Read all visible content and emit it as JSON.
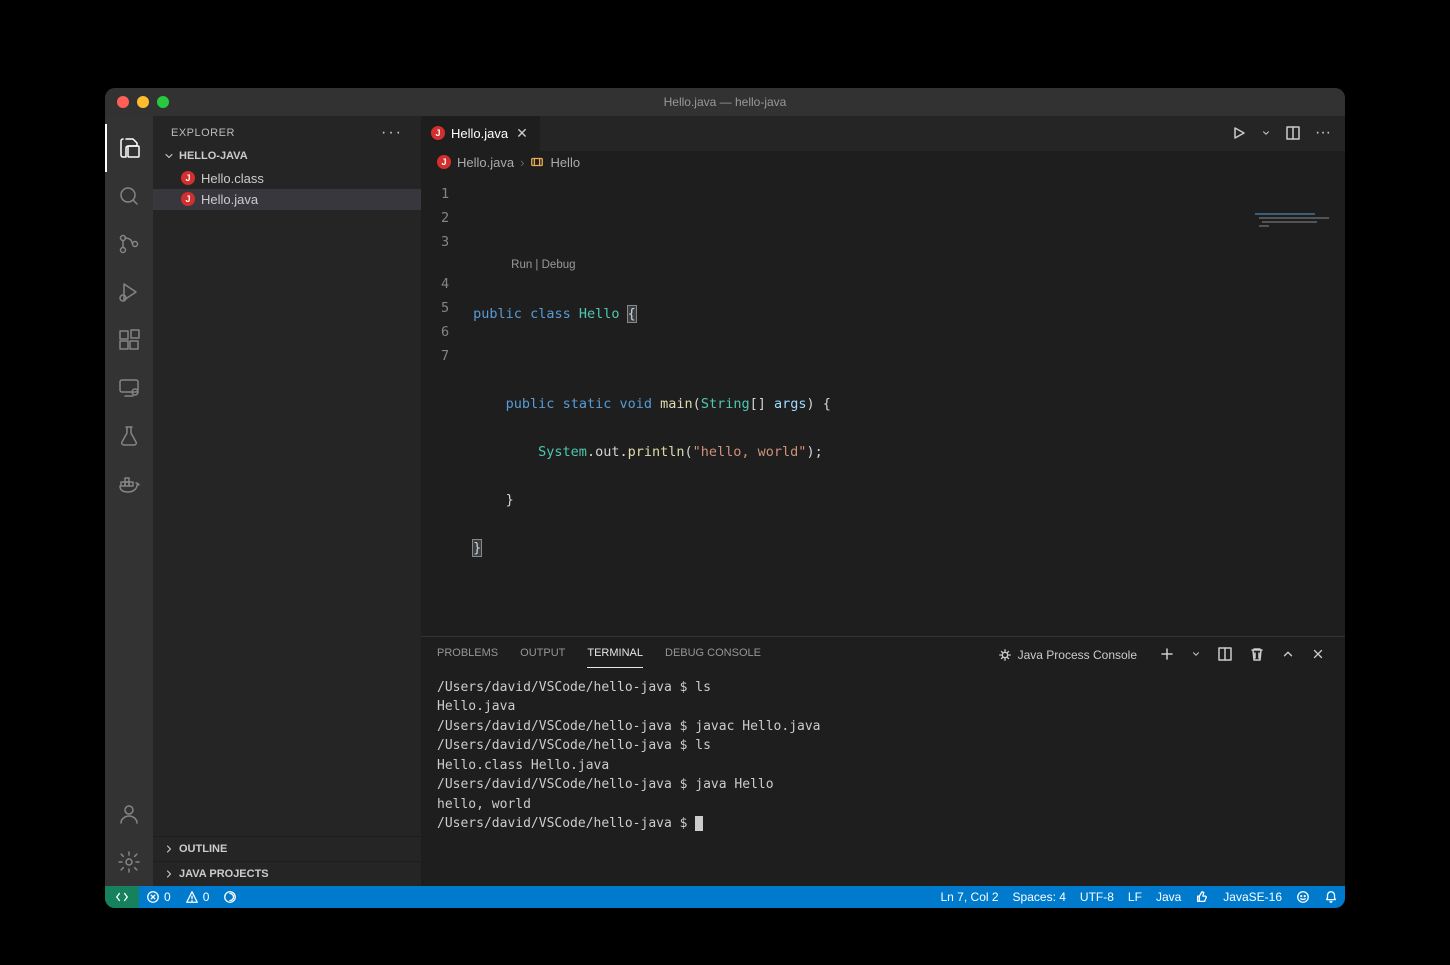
{
  "window": {
    "title": "Hello.java — hello-java"
  },
  "sidebar": {
    "title": "EXPLORER",
    "folder": "HELLO-JAVA",
    "files": [
      {
        "name": "Hello.class",
        "active": false
      },
      {
        "name": "Hello.java",
        "active": true
      }
    ],
    "panels": [
      "OUTLINE",
      "JAVA PROJECTS"
    ]
  },
  "tab": {
    "label": "Hello.java"
  },
  "breadcrumb": {
    "file": "Hello.java",
    "symbol": "Hello"
  },
  "code": {
    "lines": [
      "1",
      "2",
      "3",
      "4",
      "5",
      "6",
      "7"
    ],
    "codelens": "Run | Debug",
    "text": {
      "l3_public": "public",
      "l3_class": "class",
      "l3_Hello": "Hello",
      "l3_brace": "{",
      "l4_public": "public",
      "l4_static": "static",
      "l4_void": "void",
      "l4_main": "main",
      "l4_String": "String",
      "l4_brackets": "[]",
      "l4_args": "args",
      "l4_rest": ") {",
      "l5_System": "System",
      "l5_out": ".out.",
      "l5_println": "println",
      "l5_openp": "(",
      "l5_str": "\"hello, world\"",
      "l5_closep": ");",
      "l6_brace": "    }",
      "l7_brace": "}"
    }
  },
  "panel": {
    "tabs": [
      "PROBLEMS",
      "OUTPUT",
      "TERMINAL",
      "DEBUG CONSOLE"
    ],
    "active": "TERMINAL",
    "terminal_label": "Java Process Console"
  },
  "terminal": {
    "lines": [
      "/Users/david/VSCode/hello-java $ ls",
      "Hello.java",
      "/Users/david/VSCode/hello-java $ javac Hello.java",
      "/Users/david/VSCode/hello-java $ ls",
      "Hello.class Hello.java",
      "/Users/david/VSCode/hello-java $ java Hello",
      "hello, world",
      "/Users/david/VSCode/hello-java $ "
    ]
  },
  "status": {
    "errors": "0",
    "warnings": "0",
    "cursor": "Ln 7, Col 2",
    "spaces": "Spaces: 4",
    "encoding": "UTF-8",
    "eol": "LF",
    "lang": "Java",
    "jdk": "JavaSE-16"
  }
}
